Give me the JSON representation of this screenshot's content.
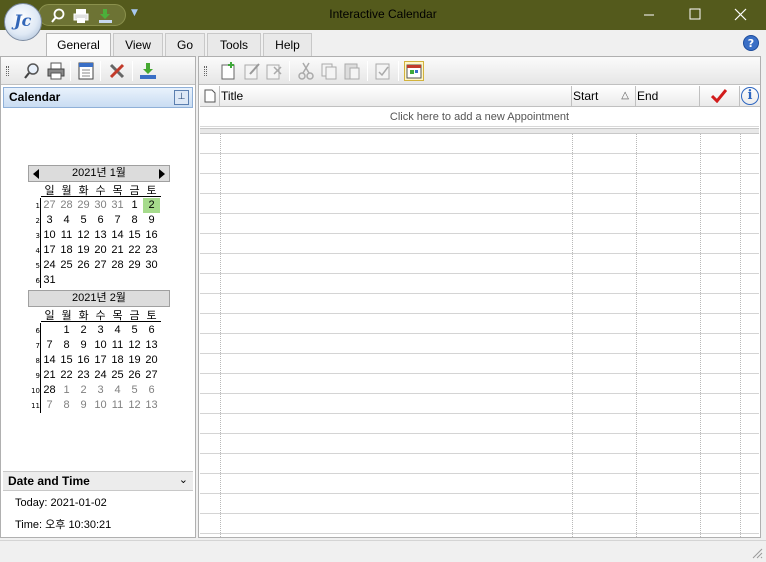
{
  "window": {
    "title": "Interactive Calendar",
    "logo_text": "Jc",
    "controls": {
      "minimize": "minimize",
      "maximize": "maximize",
      "close": "close"
    }
  },
  "menu": {
    "tabs": [
      {
        "label": "General",
        "active": true
      },
      {
        "label": "View",
        "active": false
      },
      {
        "label": "Go",
        "active": false
      },
      {
        "label": "Tools",
        "active": false
      },
      {
        "label": "Help",
        "active": false
      }
    ],
    "help_glyph": "?"
  },
  "left_toolbar": {
    "icons": [
      "search-icon",
      "print-icon",
      "calendar-view-icon",
      "settings-tools-icon",
      "download-icon"
    ]
  },
  "right_toolbar": {
    "icons": [
      "new-appointment-icon",
      "edit-icon",
      "delete-icon",
      "cut-icon",
      "copy-icon",
      "paste-icon",
      "properties-icon",
      "calendar-sync-icon"
    ]
  },
  "calendar_panel": {
    "title": "Calendar",
    "pin_glyph": "⊥",
    "months": [
      {
        "label": "2021년 1월",
        "has_nav": true,
        "dow": [
          "일",
          "월",
          "화",
          "수",
          "목",
          "금",
          "토"
        ],
        "weeks": [
          {
            "num": "1",
            "days": [
              "27",
              "28",
              "29",
              "30",
              "31",
              "1",
              "2"
            ]
          },
          {
            "num": "2",
            "days": [
              "3",
              "4",
              "5",
              "6",
              "7",
              "8",
              "9"
            ]
          },
          {
            "num": "3",
            "days": [
              "10",
              "11",
              "12",
              "13",
              "14",
              "15",
              "16"
            ]
          },
          {
            "num": "4",
            "days": [
              "17",
              "18",
              "19",
              "20",
              "21",
              "22",
              "23"
            ]
          },
          {
            "num": "5",
            "days": [
              "24",
              "25",
              "26",
              "27",
              "28",
              "29",
              "30"
            ]
          },
          {
            "num": "6",
            "days": [
              "31",
              "",
              "",
              "",
              "",
              "",
              ""
            ]
          }
        ]
      },
      {
        "label": "2021년 2월",
        "has_nav": false,
        "dow": [
          "일",
          "월",
          "화",
          "수",
          "목",
          "금",
          "토"
        ],
        "weeks": [
          {
            "num": "6",
            "days": [
              "",
              "1",
              "2",
              "3",
              "4",
              "5",
              "6"
            ]
          },
          {
            "num": "7",
            "days": [
              "7",
              "8",
              "9",
              "10",
              "11",
              "12",
              "13"
            ]
          },
          {
            "num": "8",
            "days": [
              "14",
              "15",
              "16",
              "17",
              "18",
              "19",
              "20"
            ]
          },
          {
            "num": "9",
            "days": [
              "21",
              "22",
              "23",
              "24",
              "25",
              "26",
              "27"
            ]
          },
          {
            "num": "10",
            "days": [
              "28",
              "1",
              "2",
              "3",
              "4",
              "5",
              "6"
            ]
          },
          {
            "num": "11",
            "days": [
              "7",
              "8",
              "9",
              "10",
              "11",
              "12",
              "13"
            ]
          }
        ]
      }
    ],
    "today_highlight_color": "#a6db8c"
  },
  "date_time_panel": {
    "title": "Date and Time",
    "chevron": "⌄",
    "today_text": "Today: 2021-01-02",
    "time_text": "Time: 오후 10:30:21"
  },
  "appointments": {
    "columns": [
      {
        "label": "",
        "icon": "document-icon"
      },
      {
        "label": "Title"
      },
      {
        "label": "Start",
        "sort": "△"
      },
      {
        "label": "End"
      },
      {
        "label": "",
        "icon": "checkmark-icon"
      },
      {
        "label": "",
        "icon": "info-icon"
      }
    ],
    "add_prompt": "Click here to add a new Appointment",
    "rows": []
  },
  "colors": {
    "titlebar": "#545a1c",
    "accent_blue": "#3a6fc6",
    "check_red": "#d21c1c"
  }
}
